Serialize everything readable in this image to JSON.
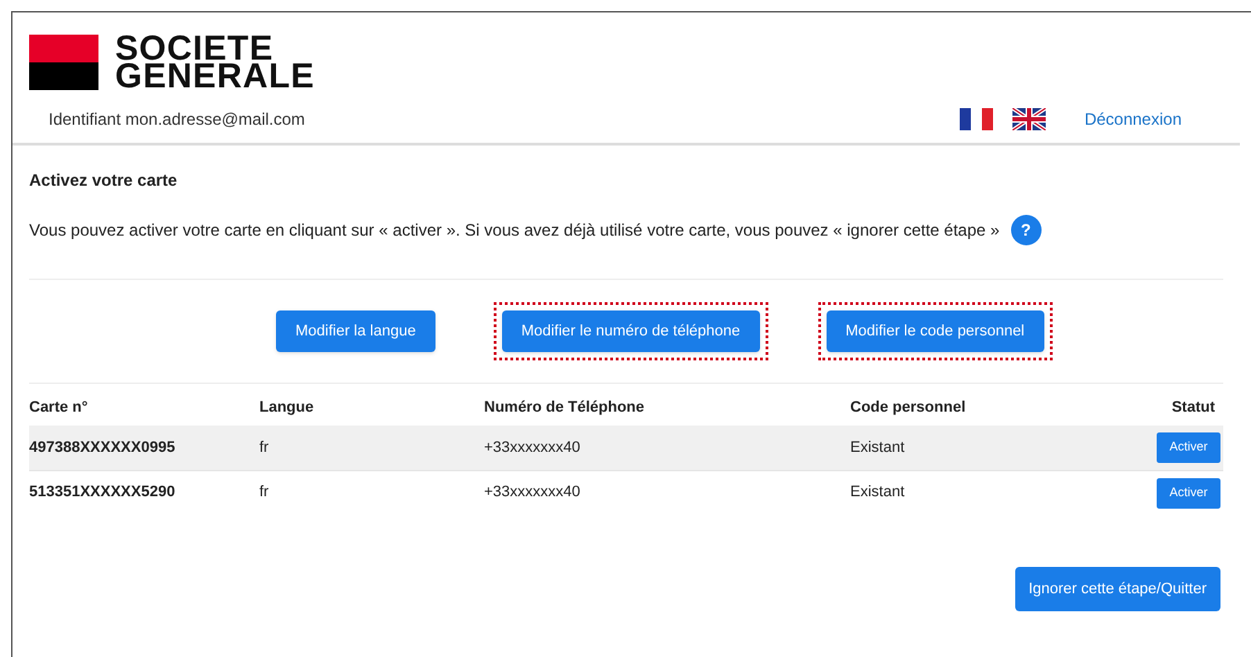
{
  "logo": {
    "line_1": "SOCIETE",
    "line_2": "GENERALE"
  },
  "identifier": {
    "label": "Identifiant",
    "value": "mon.adresse@mail.com"
  },
  "languages": [
    {
      "kind": "fr"
    },
    {
      "kind": "gb"
    }
  ],
  "logout_link": "Déconnexion",
  "section_title": "Activez votre carte",
  "intro": "Vous pouvez activer votre carte en cliquant sur « activer ». Si vous avez déjà utilisé votre carte, vous pouvez « ignorer cette étape »",
  "help_icon": "?",
  "actions": [
    {
      "label": "Modifier la langue",
      "highlighted": false
    },
    {
      "label": "Modifier le numéro de téléphone",
      "highlighted": true
    },
    {
      "label": "Modifier le code personnel",
      "highlighted": true
    }
  ],
  "table": {
    "columns": [
      "Carte n°",
      "Langue",
      "Numéro de Téléphone",
      "Code personnel",
      "Statut"
    ],
    "rows": [
      {
        "card": "497388XXXXXX0995",
        "language": "fr",
        "phone": "+33xxxxxxx40",
        "code": "Existant",
        "action": "Activer"
      },
      {
        "card": "513351XXXXXX5290",
        "language": "fr",
        "phone": "+33xxxxxxx40",
        "code": "Existant",
        "action": "Activer"
      }
    ]
  },
  "skip_button": "Ignorer cette étape/Quitter"
}
